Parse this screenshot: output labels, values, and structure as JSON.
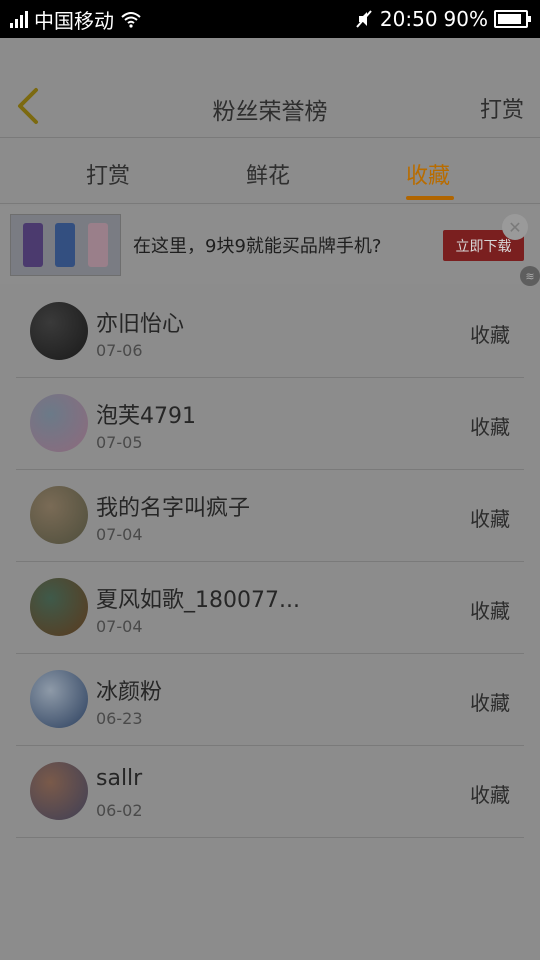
{
  "status_bar": {
    "carrier": "中国移动",
    "time": "20:50",
    "battery": "90%",
    "battery_level": 0.9,
    "icons": [
      "signal-icon",
      "wifi-icon",
      "mute-icon",
      "battery-icon"
    ]
  },
  "header": {
    "title": "粉丝荣誉榜",
    "right_link": "打赏",
    "back_icon": "chevron-left-icon"
  },
  "tabs": [
    {
      "label": "打赏",
      "active": false
    },
    {
      "label": "鲜花",
      "active": false
    },
    {
      "label": "收藏",
      "active": true
    }
  ],
  "accent_color": "#b86c00",
  "ad": {
    "text": "在这里，9块9就能买品牌手机?",
    "button": "立即下载",
    "close_icon": "close-icon"
  },
  "list": [
    {
      "name": "亦旧怡心",
      "date": "07-06",
      "action": "收藏",
      "avatar_colors": [
        "#1a1a1a",
        "#3a3a3a"
      ]
    },
    {
      "name": "泡芙4791",
      "date": "07-05",
      "action": "收藏",
      "avatar_colors": [
        "#8e6a7d",
        "#6b7a88"
      ]
    },
    {
      "name": "我的名字叫疯子",
      "date": "07-04",
      "action": "收藏",
      "avatar_colors": [
        "#4e4e3c",
        "#7a6b56"
      ]
    },
    {
      "name": "夏风如歌_180077...",
      "date": "07-04",
      "action": "收藏",
      "avatar_colors": [
        "#5a3a1e",
        "#3f5a4a"
      ]
    },
    {
      "name": "冰颜粉",
      "date": "06-23",
      "action": "收藏",
      "avatar_colors": [
        "#2b3f5e",
        "#8e9aa8"
      ]
    },
    {
      "name": "sallr",
      "date": "06-02",
      "action": "收藏",
      "avatar_colors": [
        "#3f3f55",
        "#7a5a4a"
      ]
    }
  ]
}
